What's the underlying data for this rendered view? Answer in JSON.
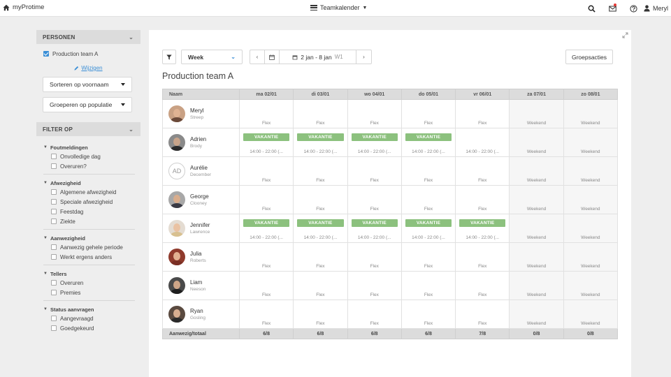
{
  "topbar": {
    "app_name": "myProtime",
    "nav_title": "Teamkalender",
    "user_name": "Meryl",
    "icons": [
      "home-icon",
      "menu-icon",
      "search-icon",
      "mail-icon",
      "help-icon",
      "user-icon"
    ],
    "notification_color": "#e53935"
  },
  "sidebar": {
    "persons_header": "PERSONEN",
    "team_label": "Production team A",
    "team_checked": true,
    "edit_label": "Wijzigen",
    "sort_label": "Sorteren op voornaam",
    "group_label": "Groeperen op populatie",
    "filter_header": "FILTER OP",
    "groups": [
      {
        "title": "Foutmeldingen",
        "items": [
          "Onvolledige dag",
          "Overuren?"
        ]
      },
      {
        "title": "Afwezigheid",
        "items": [
          "Algemene afwezigheid",
          "Speciale afwezigheid",
          "Feestdag",
          "Ziekte"
        ]
      },
      {
        "title": "Aanwezigheid",
        "items": [
          "Aanwezig gehele periode",
          "Werkt ergens anders"
        ]
      },
      {
        "title": "Tellers",
        "items": [
          "Overuren",
          "Premies"
        ]
      },
      {
        "title": "Status aanvragen",
        "items": [
          "Aangevraagd",
          "Goedgekeurd"
        ]
      }
    ]
  },
  "toolbar": {
    "view": "Week",
    "date_range": "2 jan - 8 jan",
    "week_num": "W1",
    "group_actions": "Groepsacties"
  },
  "calendar": {
    "title": "Production team A",
    "name_header": "Naam",
    "days": [
      {
        "label": "ma 02/01",
        "weekend": false
      },
      {
        "label": "di 03/01",
        "weekend": false
      },
      {
        "label": "wo 04/01",
        "weekend": false
      },
      {
        "label": "do 05/01",
        "weekend": false
      },
      {
        "label": "vr 06/01",
        "weekend": false
      },
      {
        "label": "za 07/01",
        "weekend": true
      },
      {
        "label": "zo 08/01",
        "weekend": true
      }
    ],
    "vacation_label": "VAKANTIE",
    "vacation_color": "#8cc17e",
    "people": [
      {
        "first": "Meryl",
        "last": "Streep",
        "initials": "",
        "skin": "#e0b393",
        "shirt": "#6b4a3a",
        "bg": "#c9a184",
        "cells": [
          {
            "badge": false,
            "text": "Flex"
          },
          {
            "badge": false,
            "text": "Flex"
          },
          {
            "badge": false,
            "text": "Flex"
          },
          {
            "badge": false,
            "text": "Flex"
          },
          {
            "badge": false,
            "text": "Flex"
          },
          {
            "badge": false,
            "text": "Weekend"
          },
          {
            "badge": false,
            "text": "Weekend"
          }
        ]
      },
      {
        "first": "Adrien",
        "last": "Brody",
        "initials": "",
        "skin": "#c8a48a",
        "shirt": "#2b2b2b",
        "bg": "#8a8a8a",
        "cells": [
          {
            "badge": true,
            "text": "14:00 - 22:00 (..."
          },
          {
            "badge": true,
            "text": "14:00 - 22:00 (..."
          },
          {
            "badge": true,
            "text": "14:00 - 22:00 (..."
          },
          {
            "badge": true,
            "text": "14:00 - 22:00 (..."
          },
          {
            "badge": false,
            "text": "14:00 - 22:00 (..."
          },
          {
            "badge": false,
            "text": "Weekend"
          },
          {
            "badge": false,
            "text": "Weekend"
          }
        ]
      },
      {
        "first": "Aurélie",
        "last": "December",
        "initials": "AD",
        "skin": "",
        "shirt": "",
        "bg": "",
        "cells": [
          {
            "badge": false,
            "text": "Flex"
          },
          {
            "badge": false,
            "text": "Flex"
          },
          {
            "badge": false,
            "text": "Flex"
          },
          {
            "badge": false,
            "text": "Flex"
          },
          {
            "badge": false,
            "text": "Flex"
          },
          {
            "badge": false,
            "text": "Weekend"
          },
          {
            "badge": false,
            "text": "Weekend"
          }
        ]
      },
      {
        "first": "George",
        "last": "Clooney",
        "initials": "",
        "skin": "#d9ad8c",
        "shirt": "#3a3a44",
        "bg": "#a8a8a8",
        "cells": [
          {
            "badge": false,
            "text": "Flex"
          },
          {
            "badge": false,
            "text": "Flex"
          },
          {
            "badge": false,
            "text": "Flex"
          },
          {
            "badge": false,
            "text": "Flex"
          },
          {
            "badge": false,
            "text": "Flex"
          },
          {
            "badge": false,
            "text": "Weekend"
          },
          {
            "badge": false,
            "text": "Weekend"
          }
        ]
      },
      {
        "first": "Jennifer",
        "last": "Lawrence",
        "initials": "",
        "skin": "#eac2a2",
        "shirt": "#d8c090",
        "bg": "#e4dcd2",
        "cells": [
          {
            "badge": true,
            "text": "14:00 - 22:00 (..."
          },
          {
            "badge": true,
            "text": "14:00 - 22:00 (..."
          },
          {
            "badge": true,
            "text": "14:00 - 22:00 (..."
          },
          {
            "badge": true,
            "text": "14:00 - 22:00 (..."
          },
          {
            "badge": true,
            "text": "14:00 - 22:00 (..."
          },
          {
            "badge": false,
            "text": "Weekend"
          },
          {
            "badge": false,
            "text": "Weekend"
          }
        ]
      },
      {
        "first": "Julia",
        "last": "Roberts",
        "initials": "",
        "skin": "#e2b091",
        "shirt": "#7a2f24",
        "bg": "#8f3a2c",
        "cells": [
          {
            "badge": false,
            "text": "Flex"
          },
          {
            "badge": false,
            "text": "Flex"
          },
          {
            "badge": false,
            "text": "Flex"
          },
          {
            "badge": false,
            "text": "Flex"
          },
          {
            "badge": false,
            "text": "Flex"
          },
          {
            "badge": false,
            "text": "Weekend"
          },
          {
            "badge": false,
            "text": "Weekend"
          }
        ]
      },
      {
        "first": "Liam",
        "last": "Neeson",
        "initials": "",
        "skin": "#cfa688",
        "shirt": "#1e1e1e",
        "bg": "#4a4a4a",
        "cells": [
          {
            "badge": false,
            "text": "Flex"
          },
          {
            "badge": false,
            "text": "Flex"
          },
          {
            "badge": false,
            "text": "Flex"
          },
          {
            "badge": false,
            "text": "Flex"
          },
          {
            "badge": false,
            "text": "Flex"
          },
          {
            "badge": false,
            "text": "Weekend"
          },
          {
            "badge": false,
            "text": "Weekend"
          }
        ]
      },
      {
        "first": "Ryan",
        "last": "Gosling",
        "initials": "",
        "skin": "#d8ae90",
        "shirt": "#2a2a2a",
        "bg": "#5a4a40",
        "cells": [
          {
            "badge": false,
            "text": "Flex"
          },
          {
            "badge": false,
            "text": "Flex"
          },
          {
            "badge": false,
            "text": "Flex"
          },
          {
            "badge": false,
            "text": "Flex"
          },
          {
            "badge": false,
            "text": "Flex"
          },
          {
            "badge": false,
            "text": "Weekend"
          },
          {
            "badge": false,
            "text": "Weekend"
          }
        ]
      }
    ],
    "totals_label": "Aanwezig/totaal",
    "totals": [
      "6/8",
      "6/8",
      "6/8",
      "6/8",
      "7/8",
      "0/8",
      "0/8"
    ]
  }
}
